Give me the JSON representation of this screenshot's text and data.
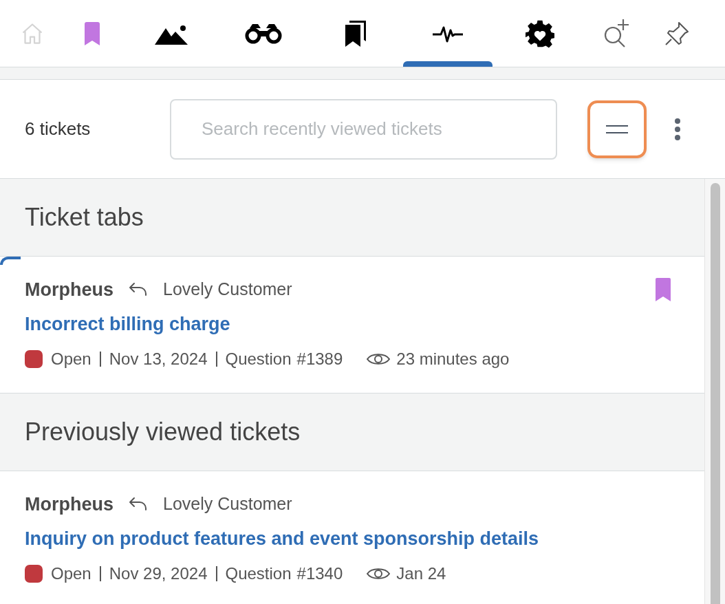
{
  "nav_tabs": [
    {
      "kind": "home",
      "selected": false
    },
    {
      "kind": "bookmark",
      "selected": false
    },
    {
      "kind": "image",
      "selected": false
    },
    {
      "kind": "binoculars",
      "selected": false
    },
    {
      "kind": "bookmarks",
      "selected": false
    },
    {
      "kind": "activity",
      "selected": true
    },
    {
      "kind": "gear",
      "selected": false
    },
    {
      "kind": "search-plus",
      "selected": false
    },
    {
      "kind": "pin",
      "selected": false
    }
  ],
  "toolbar": {
    "count": "6 tickets",
    "search": {
      "placeholder": "Search recently viewed tickets"
    },
    "sort_button_focused": true
  },
  "sections": [
    {
      "title": "Ticket tabs",
      "tickets": [
        {
          "author": "Morpheus",
          "recipient": "Lovely Customer",
          "subject": "Incorrect billing charge",
          "status": "Open",
          "color": "#c0393e",
          "date": "Nov 13, 2024",
          "type": "Question",
          "number": "#1389",
          "viewed": "23 minutes ago",
          "bookmarked": true,
          "active": true
        }
      ]
    },
    {
      "title": "Previously viewed tickets",
      "tickets": [
        {
          "author": "Morpheus",
          "recipient": "Lovely Customer",
          "subject": "Inquiry on product features and event sponsorship details",
          "status": "Open",
          "color": "#c0393e",
          "date": "Nov 29, 2024",
          "type": "Question",
          "number": "#1340",
          "viewed": "Jan 24",
          "bookmarked": false,
          "active": false
        }
      ]
    }
  ]
}
